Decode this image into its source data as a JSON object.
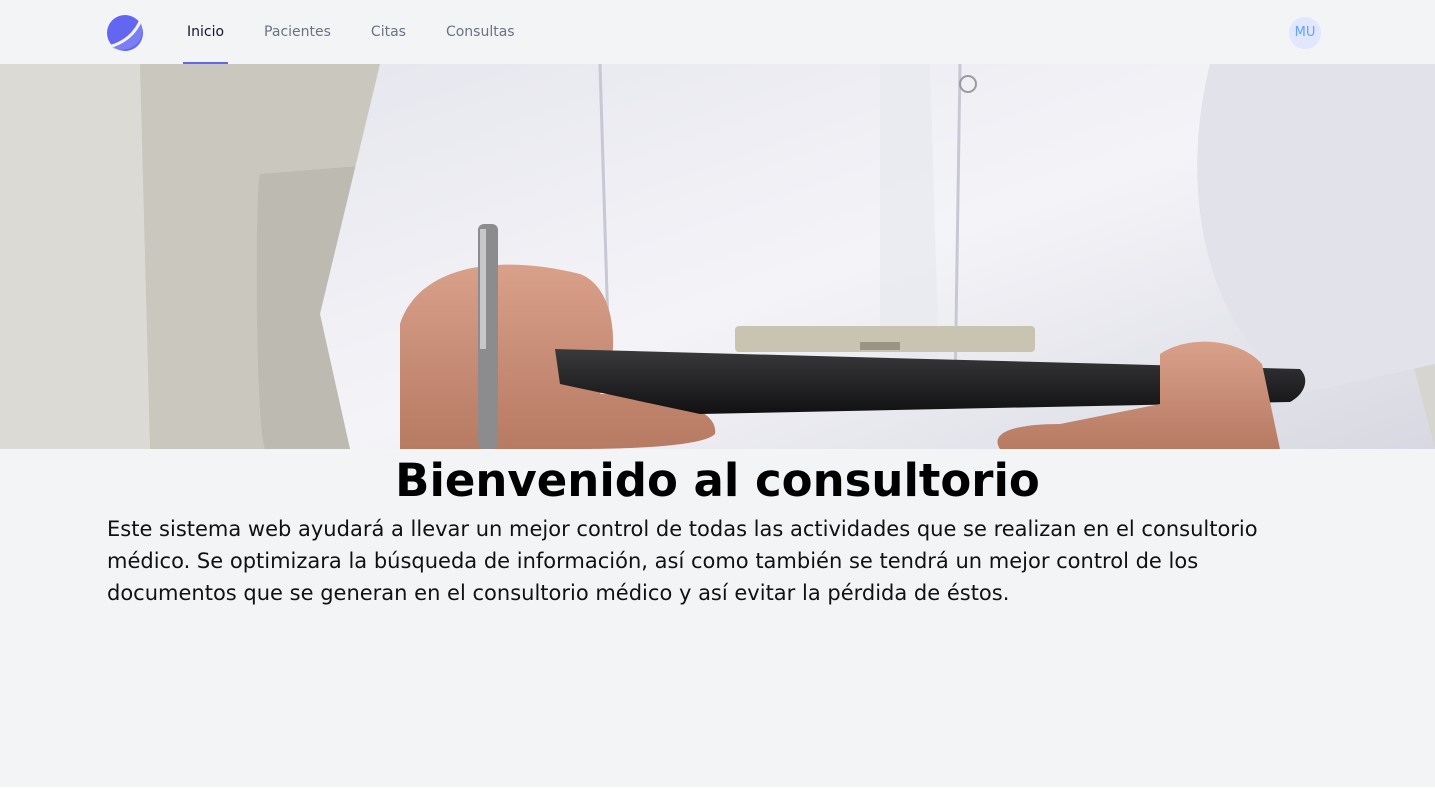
{
  "nav": {
    "logo_icon": "crescent-logo-icon",
    "items": [
      {
        "label": "Inicio",
        "active": true
      },
      {
        "label": "Pacientes",
        "active": false
      },
      {
        "label": "Citas",
        "active": false
      },
      {
        "label": "Consultas",
        "active": false
      }
    ],
    "avatar_initials": "MU",
    "accent_color": "#6366f1"
  },
  "hero": {
    "image": "doctor-holding-clipboard-photo"
  },
  "main": {
    "title": "Bienvenido al consultorio",
    "description": "Este sistema web ayudará a llevar un mejor control de todas las actividades que se realizan en el consultorio médico. Se optimizara la búsqueda de información, así como también se tendrá un mejor control de los documentos que se generan en el consultorio médico y así evitar la pérdida de éstos."
  }
}
